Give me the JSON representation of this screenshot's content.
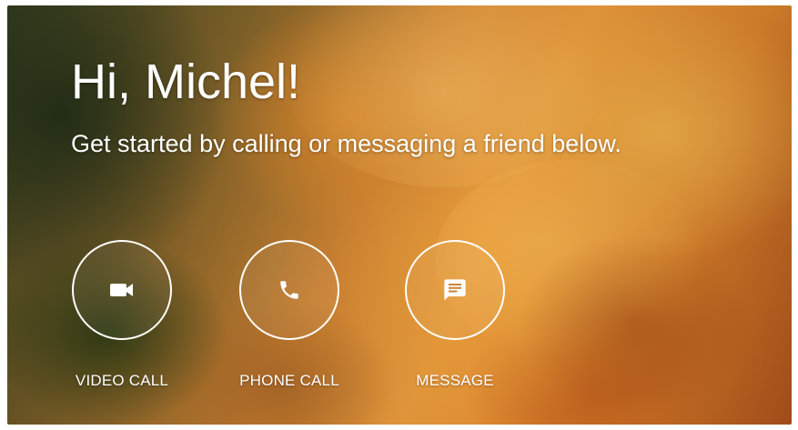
{
  "greeting": {
    "title": "Hi, Michel!",
    "subtitle": "Get started by calling or messaging a friend below."
  },
  "actions": [
    {
      "label": "VIDEO CALL",
      "icon": "videocam-icon"
    },
    {
      "label": "PHONE CALL",
      "icon": "phone-icon"
    },
    {
      "label": "MESSAGE",
      "icon": "message-icon"
    }
  ],
  "colors": {
    "text": "#ffffff",
    "background_warm": "#f0a03e",
    "background_dark": "#3e4a25"
  }
}
